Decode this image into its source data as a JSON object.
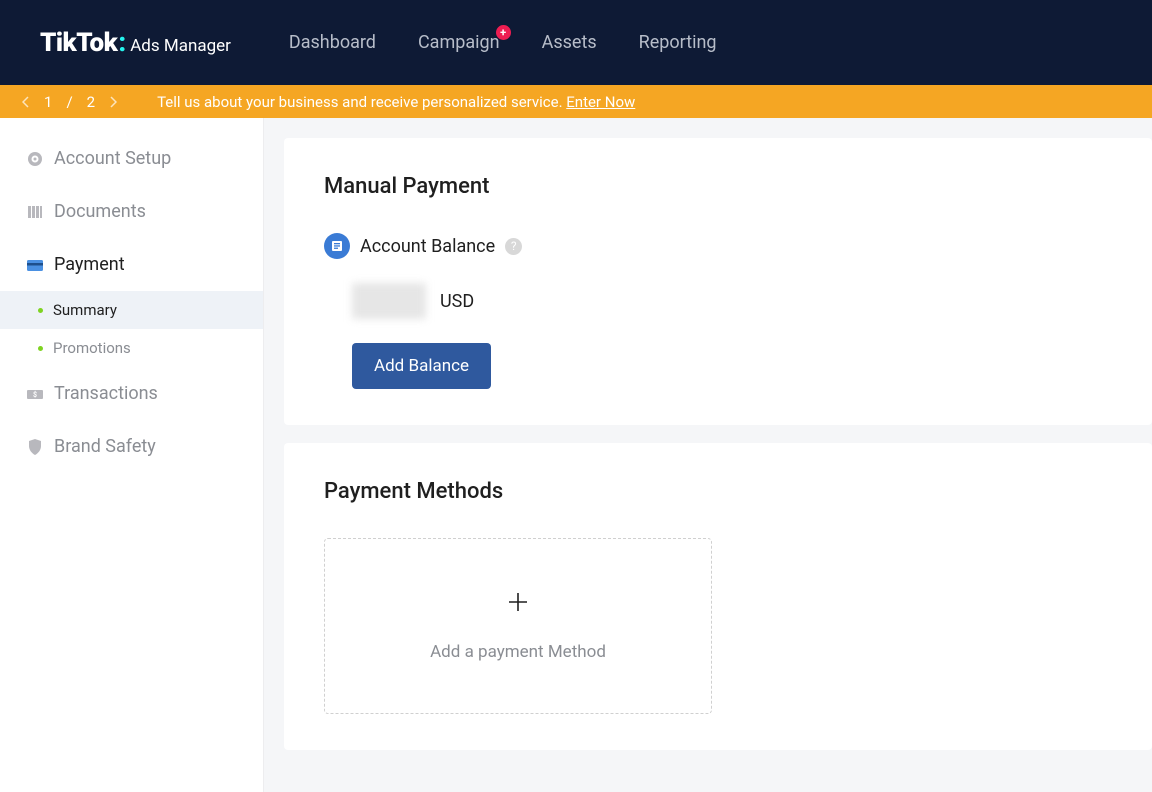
{
  "header": {
    "logo_brand": "TikTok",
    "logo_colon": ":",
    "logo_sub": "Ads Manager",
    "nav": {
      "dashboard": "Dashboard",
      "campaign": "Campaign",
      "campaign_badge": "+",
      "assets": "Assets",
      "reporting": "Reporting"
    }
  },
  "banner": {
    "current": "1",
    "sep": "/",
    "total": "2",
    "text": "Tell us about your business and receive personalized service. ",
    "link": "Enter Now"
  },
  "sidebar": {
    "account_setup": "Account Setup",
    "documents": "Documents",
    "payment": "Payment",
    "summary": "Summary",
    "promotions": "Promotions",
    "transactions": "Transactions",
    "brand_safety": "Brand Safety"
  },
  "main": {
    "manual_payment_title": "Manual Payment",
    "account_balance_label": "Account Balance",
    "help_symbol": "?",
    "currency": "USD",
    "add_balance_btn": "Add Balance",
    "payment_methods_title": "Payment Methods",
    "add_method_text": "Add a payment Method"
  }
}
